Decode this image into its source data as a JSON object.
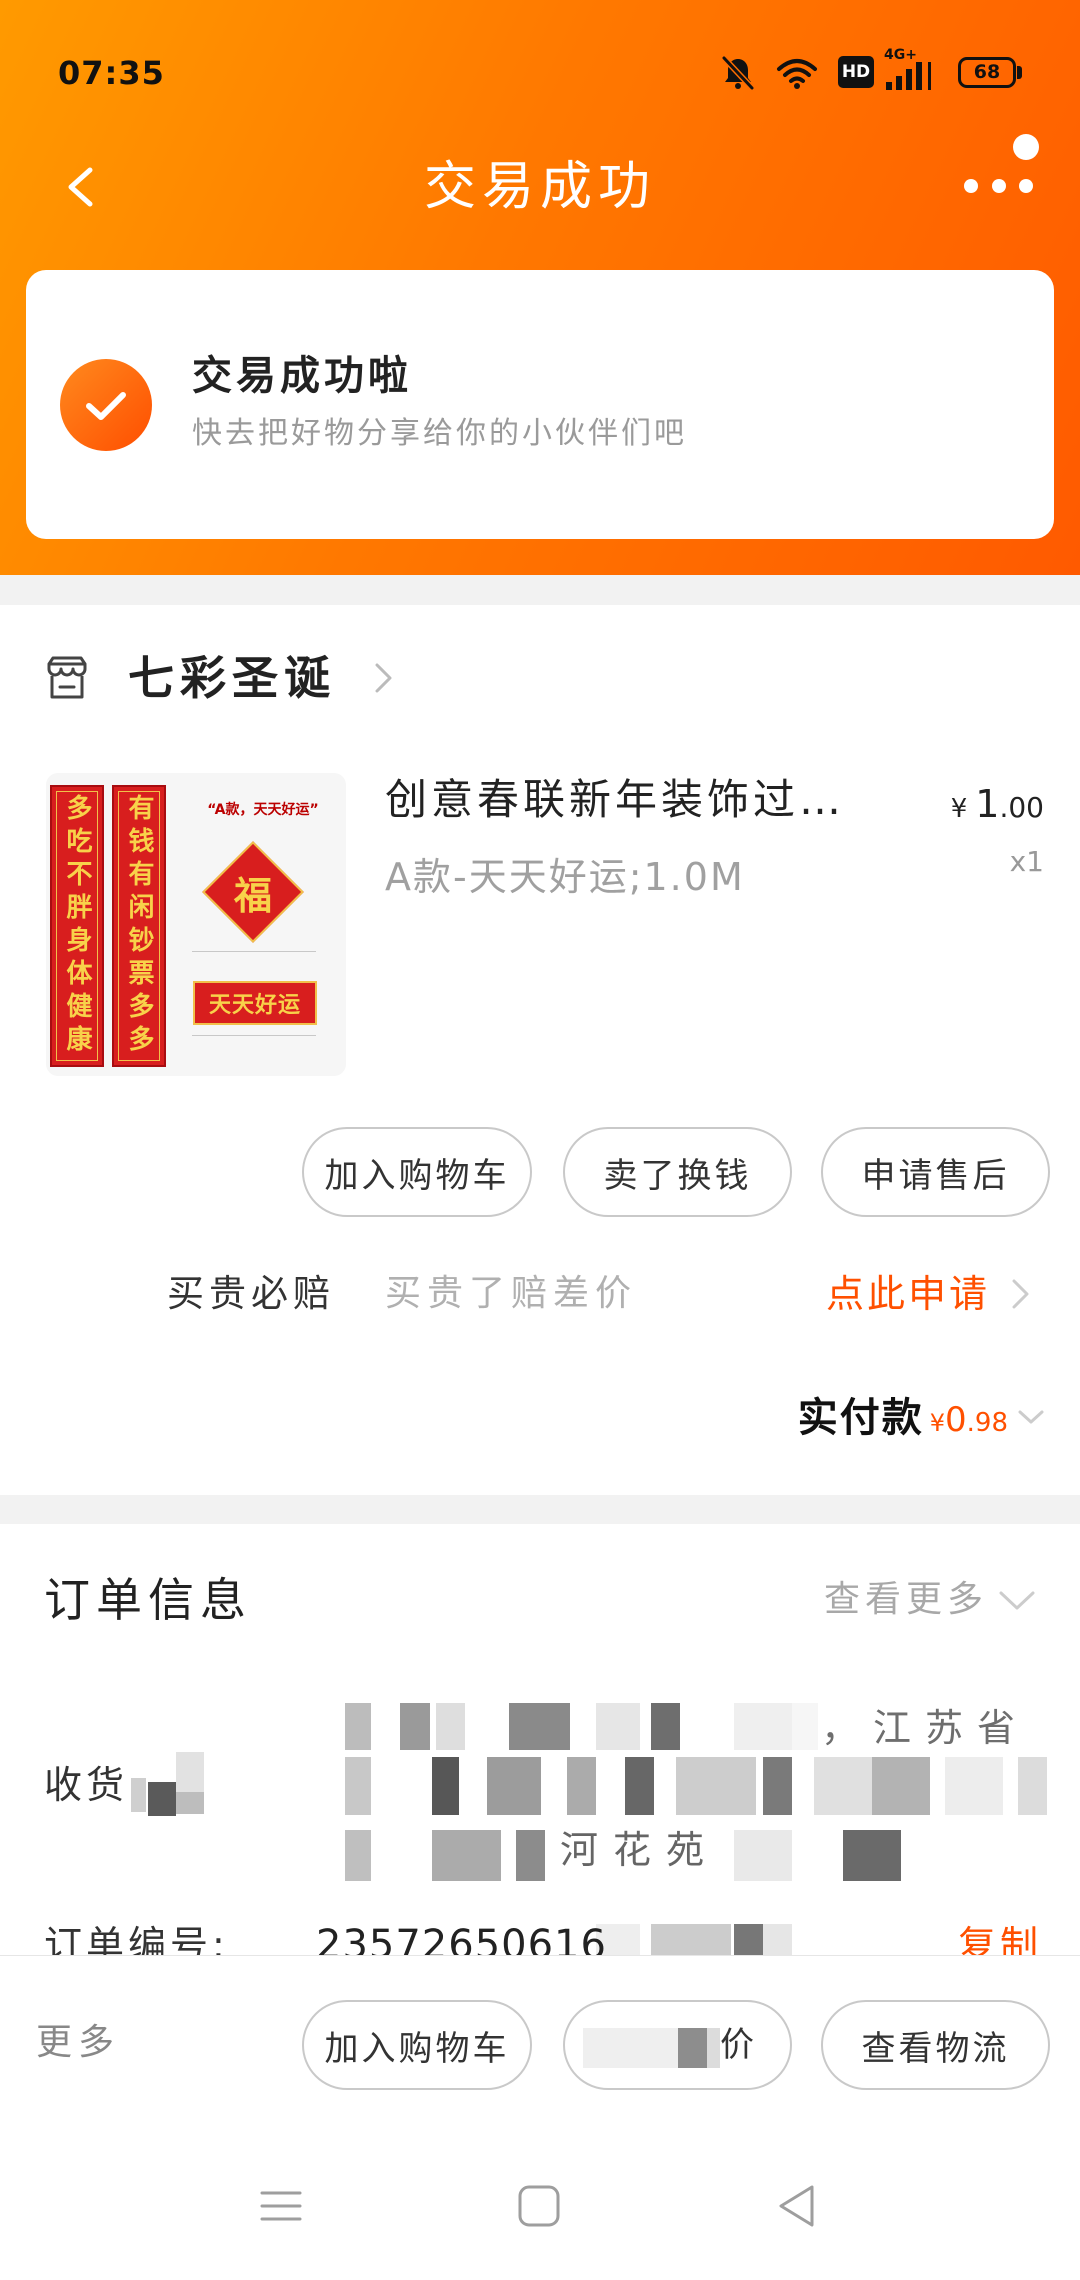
{
  "status_bar": {
    "time": "07:35",
    "hd_label": "HD",
    "network_label": "4G+",
    "battery_level": "68",
    "icons": [
      "bell-off-icon",
      "wifi-icon",
      "signal-icon",
      "battery-icon"
    ]
  },
  "header": {
    "title": "交易成功",
    "icons": [
      "back-chevron-icon",
      "more-dots-icon"
    ]
  },
  "success_card": {
    "title": "交易成功啦",
    "subtitle": "快去把好物分享给你的小伙伴们吧",
    "icon": "check-circle-icon"
  },
  "shop": {
    "name": "七彩圣诞",
    "icon": "store-icon"
  },
  "product": {
    "title": "创意春联新年装饰过…",
    "spec": "A款-天天好运;1.0M",
    "price": {
      "currency": "¥",
      "integer": "1",
      "decimal": ".00"
    },
    "quantity": "x1",
    "image": {
      "label": "“A款，天天好运”",
      "left_couplet": "多吃不胖身体健康",
      "right_couplet": "有钱有闲钞票多多",
      "diamond": "福",
      "banner": "天天好运"
    }
  },
  "order_actions": [
    "加入购物车",
    "卖了换钱",
    "申请售后"
  ],
  "price_guarantee": {
    "label": "买贵必赔",
    "description": "买贵了赔差价",
    "link": "点此申请"
  },
  "payment": {
    "label": "实付款",
    "currency": "¥",
    "integer": "0",
    "decimal": ".98"
  },
  "order_info": {
    "title": "订单信息",
    "more": "查看更多",
    "recipient_label": "收货",
    "address_fragments": [
      "，江苏省",
      "河花苑"
    ],
    "order_no_label": "订单编号:",
    "order_no": "23572650616",
    "copy": "复制"
  },
  "bottom_bar": {
    "more": "更多",
    "actions": [
      "加入购物车",
      "价",
      "查看物流"
    ]
  },
  "navigation_bar": {
    "icons": [
      "menu-icon",
      "home-square-icon",
      "back-triangle-icon"
    ]
  },
  "colors": {
    "accent": "#FF5000",
    "header_gradient_start": "#FF9A00",
    "header_gradient_end": "#FF5A00"
  }
}
